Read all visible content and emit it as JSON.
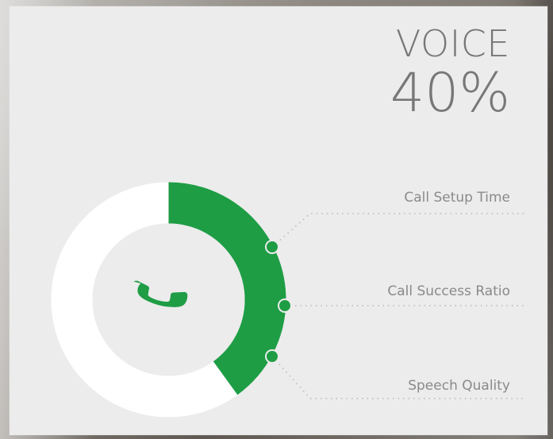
{
  "header": {
    "title": "VOICE",
    "percentage": "40%"
  },
  "chart": {
    "progress": 40,
    "remaining": 60
  },
  "metrics": [
    {
      "label": "Call Setup Time"
    },
    {
      "label": "Call Success Ratio"
    },
    {
      "label": "Speech Quality"
    }
  ],
  "colors": {
    "accent": "#1e9d45",
    "card": "#ececec",
    "ring": "#ffffff",
    "text": "#777777",
    "muted": "#8a8a8a"
  },
  "icons": {
    "center": "phone-icon"
  }
}
